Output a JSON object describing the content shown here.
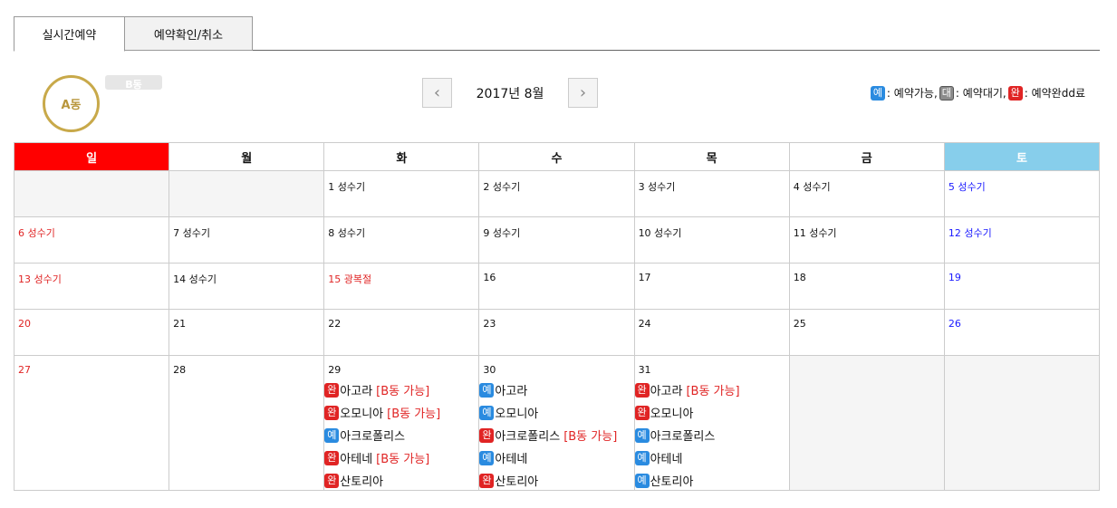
{
  "tabs": [
    {
      "label": "실시간예약",
      "active": true
    },
    {
      "label": "예약확인/취소",
      "active": false
    }
  ],
  "buildings": {
    "a": "A동",
    "b": "B동"
  },
  "month_label": "2017년 8월",
  "legend": {
    "available_badge": "예",
    "available_text": ": 예약가능,",
    "waiting_badge": "대",
    "waiting_text": ": 예약대기,",
    "done_badge": "완",
    "done_text": ": 예약완dd료"
  },
  "weekdays": [
    "일",
    "월",
    "화",
    "수",
    "목",
    "금",
    "토"
  ],
  "weeks": [
    [
      null,
      null,
      "1 성수기",
      "2 성수기",
      "3 성수기",
      "4 성수기",
      "5 성수기"
    ],
    [
      "6 성수기",
      "7 성수기",
      "8 성수기",
      "9 성수기",
      "10 성수기",
      "11 성수기",
      "12 성수기"
    ],
    [
      "13 성수기",
      "14 성수기",
      "15 광복절",
      "16",
      "17",
      "18",
      "19"
    ],
    [
      "20",
      "21",
      "22",
      "23",
      "24",
      "25",
      "26"
    ],
    [
      "27",
      "28",
      "29",
      "30",
      "31",
      null,
      null
    ]
  ],
  "reservations": {
    "29": [
      {
        "badge": "완",
        "name": "아고라",
        "note": "[B동 가능]"
      },
      {
        "badge": "완",
        "name": "오모니아",
        "note": "[B동 가능]"
      },
      {
        "badge": "예",
        "name": "아크로폴리스",
        "note": ""
      },
      {
        "badge": "완",
        "name": "아테네",
        "note": "[B동 가능]"
      },
      {
        "badge": "완",
        "name": "산토리아",
        "note": ""
      }
    ],
    "30": [
      {
        "badge": "예",
        "name": "아고라",
        "note": ""
      },
      {
        "badge": "예",
        "name": "오모니아",
        "note": ""
      },
      {
        "badge": "완",
        "name": "아크로폴리스",
        "note": "[B동 가능]"
      },
      {
        "badge": "예",
        "name": "아테네",
        "note": ""
      },
      {
        "badge": "완",
        "name": "산토리아",
        "note": ""
      }
    ],
    "31": [
      {
        "badge": "완",
        "name": "아고라",
        "note": "[B동 가능]"
      },
      {
        "badge": "완",
        "name": "오모니아",
        "note": ""
      },
      {
        "badge": "예",
        "name": "아크로폴리스",
        "note": ""
      },
      {
        "badge": "예",
        "name": "아테네",
        "note": ""
      },
      {
        "badge": "예",
        "name": "산토리아",
        "note": ""
      }
    ]
  },
  "colors": {
    "sunday": "#ff0000",
    "saturday": "#87ceeb",
    "available": "#2a8be0",
    "done": "#e02424",
    "accent": "#c8a94a"
  }
}
